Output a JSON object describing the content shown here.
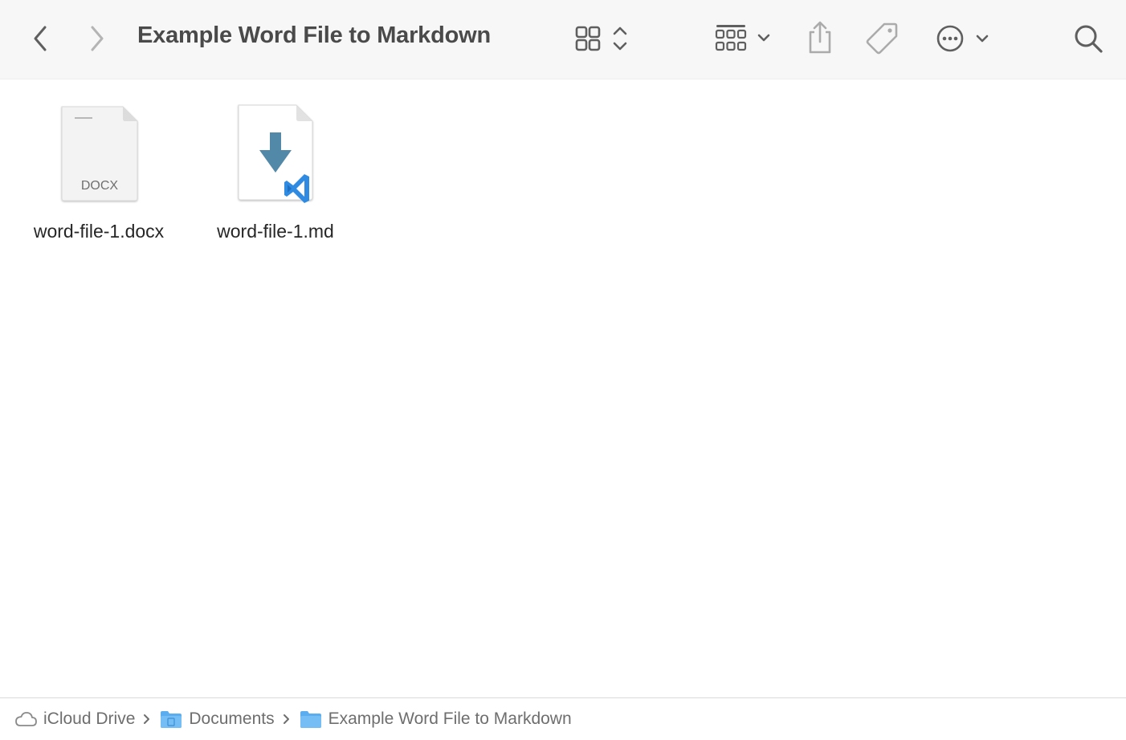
{
  "window": {
    "title": "Example Word File to Markdown"
  },
  "toolbar": {
    "back_icon": "chevron-left",
    "forward_icon": "chevron-right",
    "view_icon": "icon-grid",
    "group_icon": "group-grid",
    "share_icon": "share",
    "tag_icon": "tag",
    "more_icon": "ellipsis-circle",
    "search_icon": "magnifying-glass"
  },
  "files": [
    {
      "name": "word-file-1.docx",
      "icon": "docx-document",
      "badge": "DOCX"
    },
    {
      "name": "word-file-1.md",
      "icon": "markdown-vscode-document"
    }
  ],
  "pathbar": {
    "items": [
      {
        "label": "iCloud Drive",
        "icon": "cloud"
      },
      {
        "label": "Documents",
        "icon": "documents-folder"
      },
      {
        "label": "Example Word File to Markdown",
        "icon": "folder"
      }
    ]
  },
  "colors": {
    "toolbar_bg": "#f7f7f7",
    "icon_gray": "#5f5f5f",
    "folder_blue": "#5aaef0",
    "md_arrow": "#5289a8",
    "vscode_blue": "#2f8ae2"
  }
}
